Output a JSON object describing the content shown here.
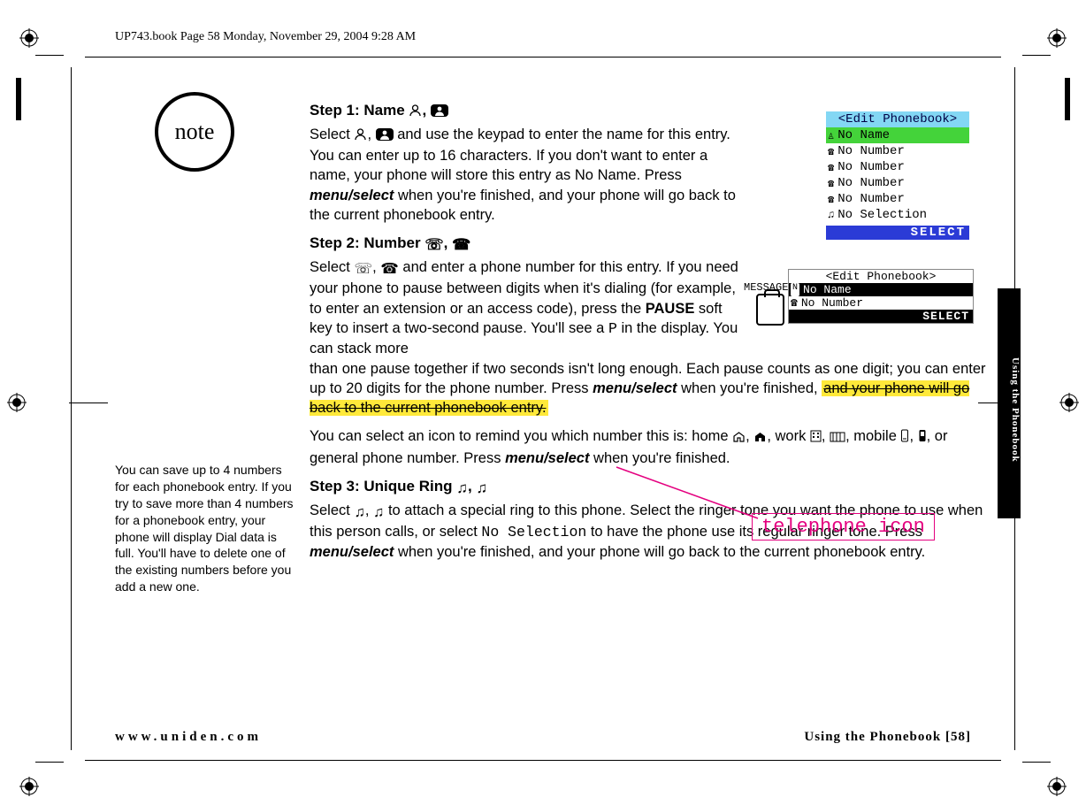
{
  "running_head": "UP743.book  Page 58  Monday, November 29, 2004  9:28 AM",
  "note_badge": "note",
  "sidebar_note": "You can save up to 4 numbers for each phonebook entry. If you try to save more than 4 numbers for a phonebook entry, your phone will display Dial data is full. You'll have to delete one of the existing numbers before you add a new one.",
  "side_tab": "Using the Phonebook",
  "step1": {
    "heading_a": "Step 1: Name ",
    "heading_b": ", ",
    "p_a": "Select ",
    "p_b": ", ",
    "p_c": " and use the keypad to enter the name for this entry. You can enter up to 16 characters. If you don't want to enter a name, your phone will store this entry as No Name. Press ",
    "menu": "menu/select",
    "p_d": " when you're finished, and your phone will go back to the current phonebook entry."
  },
  "step2": {
    "heading_a": "Step 2: Number ",
    "heading_b": ", ",
    "p_a": "Select ",
    "p_b": ", ",
    "p_c": " and enter a phone number for this entry. If you need your phone to pause between digits when it's dialing (for example, to enter an extension or an access code), press the ",
    "pause": "PAUSE",
    "p_d": " soft key to insert a two-second pause. You'll see a ",
    "pchar": "P",
    "p_e": " in the display. You can stack more than one pause together if two seconds isn't long enough. Each pause counts as one digit; you can enter up to 20 digits for the phone number. Press ",
    "menu": "menu/select",
    "p_f": " when you're finished, ",
    "hl": "and your phone will go back to the current phonebook entry.",
    "p2_a": "You can select an icon to remind you which number this is: home ",
    "p2_b": ", ",
    "p2_c": ", work ",
    "p2_d": ", ",
    "p2_e": ", mobile ",
    "p2_f": ", ",
    "p2_g": ", or general phone number. Press ",
    "p2_h": " when you're finished."
  },
  "step3": {
    "heading_a": "Step 3: Unique Ring ",
    "heading_b": ", ",
    "p_a": "Select ",
    "p_b": ", ",
    "p_c": " to attach a special ring to this phone. Select the ringer tone you want the phone to use when this person calls, or select ",
    "nosel": "No Selection",
    "p_d": " to have the phone use its regular ringer tone. Press ",
    "menu": "menu/select",
    "p_e": " when you're finished, and your phone will go back to the current phonebook entry."
  },
  "lcd1": {
    "title": "<Edit Phonebook>",
    "r1": "No Name",
    "r2": "No Number",
    "r3": "No Number",
    "r4": "No Number",
    "r5": "No Number",
    "r6": "No Selection",
    "select": "SELECT"
  },
  "lcd2": {
    "msg": "MESSAGE",
    "title": "<Edit Phonebook>",
    "r1": "No Name",
    "r2": "No Number",
    "select": "SELECT"
  },
  "callout": "telephone icon",
  "footer_left": "www.uniden.com",
  "footer_right_a": "Using the Phonebook ",
  "footer_right_b": "[58]"
}
